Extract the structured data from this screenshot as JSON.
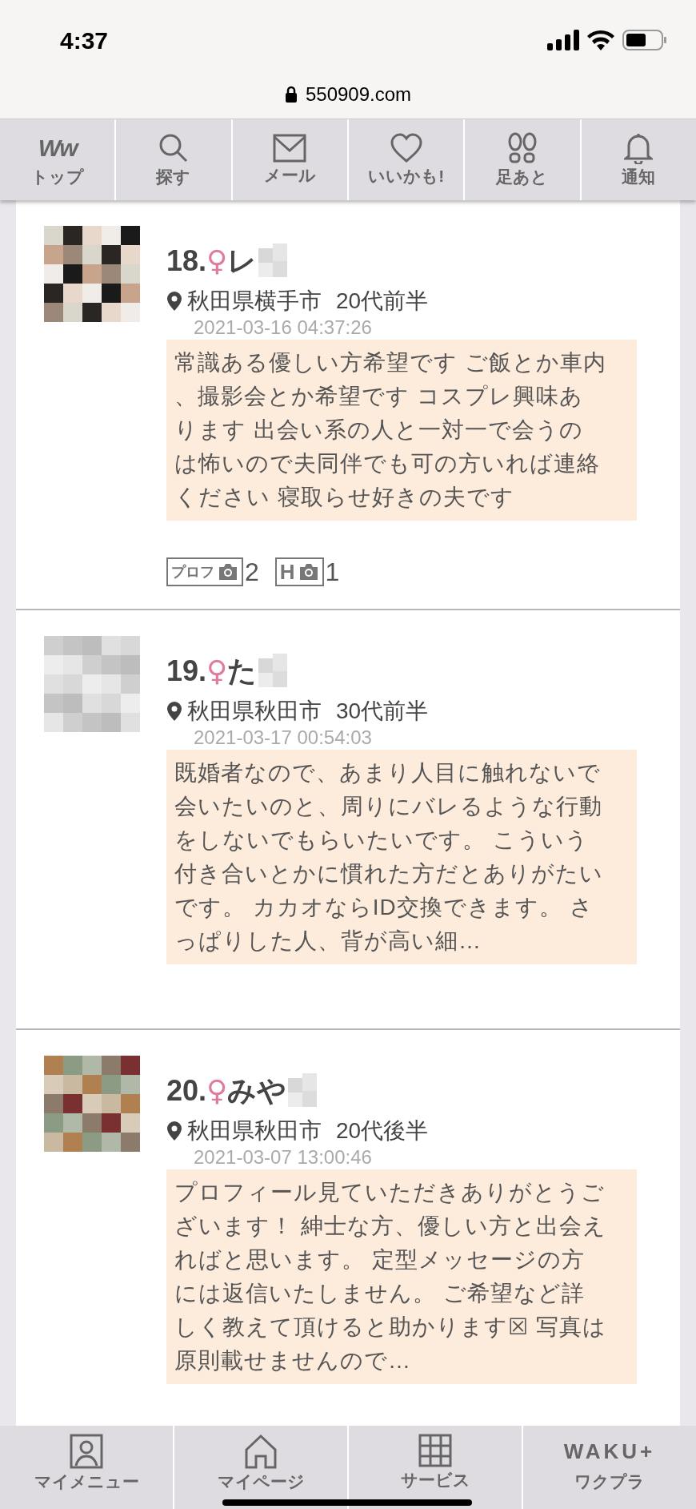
{
  "status_bar": {
    "time": "4:37"
  },
  "url_bar": {
    "url": "550909.com"
  },
  "top_nav": [
    {
      "kind": "logo",
      "logo": "Ww",
      "label": "トップ"
    },
    {
      "kind": "search",
      "label": "探す"
    },
    {
      "kind": "mail",
      "label": "メール"
    },
    {
      "kind": "heart",
      "label": "いいかも!"
    },
    {
      "kind": "footprints",
      "label": "足あと"
    },
    {
      "kind": "bell",
      "label": "通知"
    }
  ],
  "profiles": [
    {
      "number": "18.",
      "gender": "♀",
      "name": "レ",
      "location": "秋田県横手市",
      "age": "20代前半",
      "date": "2021-03-16 04:37:26",
      "message": "常識ある優しい方希望です ご飯とか車内、撮影会とか希望です コスプレ興味あります 出会い系の人と一対一で会うのは怖いので夫同伴でも可の方いれば連絡ください 寝取らせ好きの夫です",
      "badges": [
        {
          "label": "プロフ",
          "count": "2"
        },
        {
          "label": "H",
          "count": "1"
        }
      ]
    },
    {
      "number": "19.",
      "gender": "♀",
      "name": "た",
      "location": "秋田県秋田市",
      "age": "30代前半",
      "date": "2021-03-17 00:54:03",
      "message": "既婚者なので、あまり人目に触れないで会いたいのと、周りにバレるような行動をしないでもらいたいです。 こういう付き合いとかに慣れた方だとありがたいです。 カカオならID交換できます。 さっぱりした人、背が高い細…"
    },
    {
      "number": "20.",
      "gender": "♀",
      "name": "みや",
      "location": "秋田県秋田市",
      "age": "20代後半",
      "date": "2021-03-07 13:00:46",
      "message": "プロフィール見ていただきありがとうございます！ 紳士な方、優しい方と出会えればと思います。 定型メッセージの方には返信いたしません。 ご希望など詳しく教えて頂けると助かります☒ 写真は原則載せませんので…"
    }
  ],
  "bottom_nav": [
    {
      "kind": "person",
      "label": "マイメニュー"
    },
    {
      "kind": "home",
      "label": "マイページ"
    },
    {
      "kind": "grid",
      "label": "サービス"
    },
    {
      "kind": "logo",
      "logo": "WAKU+",
      "label": "ワクプラ"
    }
  ]
}
